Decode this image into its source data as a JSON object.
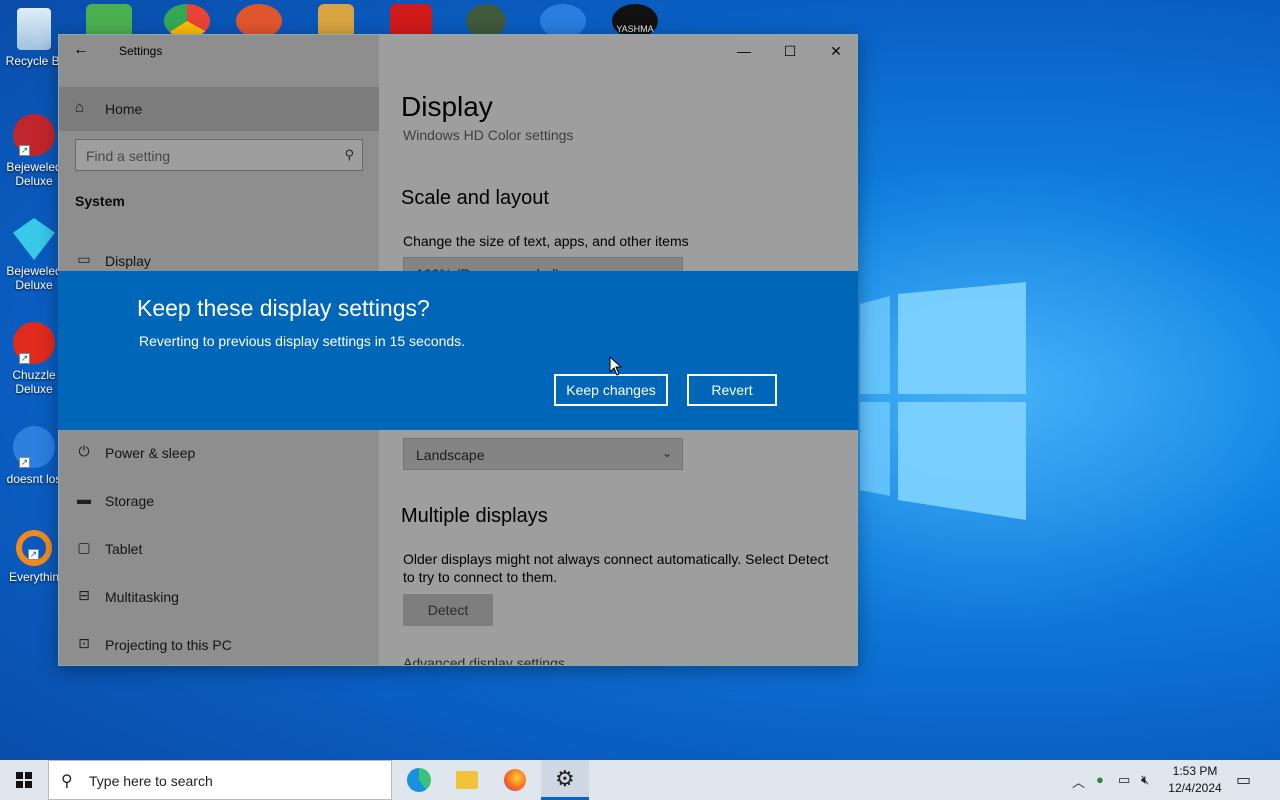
{
  "desktop": {
    "icons": [
      {
        "label": "Recycle Bi",
        "icon": "recycle-bin-icon"
      },
      {
        "label": "Bejeweled Deluxe",
        "icon": "bejeweled2-icon"
      },
      {
        "label": "Bejeweled Deluxe",
        "icon": "bejeweled-icon"
      },
      {
        "label": "Chuzzle Deluxe",
        "icon": "chuzzle-icon"
      },
      {
        "label": "doesnt los",
        "icon": "thunderbird-icon"
      },
      {
        "label": "Everythin",
        "icon": "everything-icon"
      }
    ],
    "top_icons": [
      "users-icon",
      "chrome-icon",
      "app-icon",
      "archive-icon",
      "flash-icon",
      "game-icon",
      "bird-icon",
      "yashma-icon"
    ],
    "yashma_label": "YASHMA"
  },
  "window": {
    "title": "Settings",
    "nav": {
      "home": "Home",
      "search_placeholder": "Find a setting",
      "section": "System",
      "items": [
        {
          "label": "Display",
          "icon": "monitor-icon"
        },
        {
          "label": "Power & sleep",
          "icon": "power-icon"
        },
        {
          "label": "Storage",
          "icon": "storage-icon"
        },
        {
          "label": "Tablet",
          "icon": "tablet-icon"
        },
        {
          "label": "Multitasking",
          "icon": "multitasking-icon"
        },
        {
          "label": "Projecting to this PC",
          "icon": "project-icon"
        }
      ]
    },
    "content": {
      "title": "Display",
      "hd_color_link": "Windows HD Color settings",
      "scale_heading": "Scale and layout",
      "scale_desc": "Change the size of text, apps, and other items",
      "scale_value": "100% (Recommended)",
      "orientation_value": "Landscape",
      "multi_heading": "Multiple displays",
      "multi_desc": "Older displays might not always connect automatically. Select Detect to try to connect to them.",
      "detect_button": "Detect",
      "advanced_link": "Advanced display settings"
    }
  },
  "dialog": {
    "question": "Keep these display settings?",
    "message": "Reverting to previous display settings in 15 seconds.",
    "keep_button": "Keep changes",
    "revert_button": "Revert"
  },
  "taskbar": {
    "search_placeholder": "Type here to search",
    "apps": [
      "edge-icon",
      "file-explorer-icon",
      "firefox-icon",
      "settings-icon"
    ],
    "time": "1:53 PM",
    "date": "12/4/2024"
  }
}
